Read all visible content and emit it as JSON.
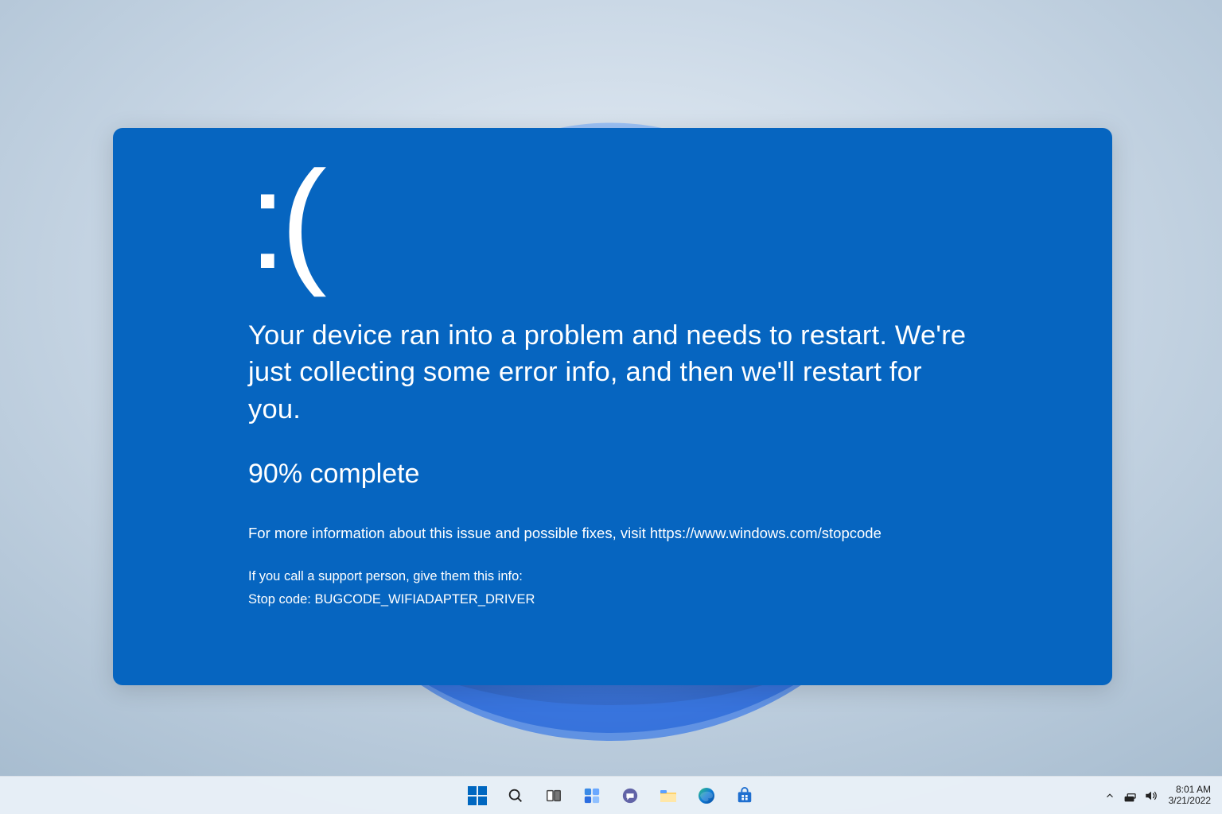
{
  "bsod": {
    "sadface": ":(",
    "message": "Your device ran into a problem and needs to restart. We're just collecting some error info, and then we'll restart for you.",
    "progress": "90% complete",
    "more_info": "For more information about this issue and possible fixes, visit https://www.windows.com/stopcode",
    "support_line": "If you call a support person, give them this info:",
    "stopcode_label": "Stop code: ",
    "stopcode_value": "BUGCODE_WIFIADAPTER_DRIVER"
  },
  "taskbar": {
    "icons": {
      "start": "start-icon",
      "search": "search-icon",
      "taskview": "task-view-icon",
      "widgets": "widgets-icon",
      "chat": "chat-icon",
      "explorer": "file-explorer-icon",
      "edge": "edge-icon",
      "store": "store-icon"
    },
    "tray": {
      "chevron": "chevron-up-icon",
      "network": "network-icon",
      "volume": "volume-icon"
    },
    "clock": {
      "time": "8:01 AM",
      "date": "3/21/2022"
    }
  },
  "colors": {
    "bsod_bg": "#0665c0",
    "taskbar_bg": "#ecf2f8"
  }
}
